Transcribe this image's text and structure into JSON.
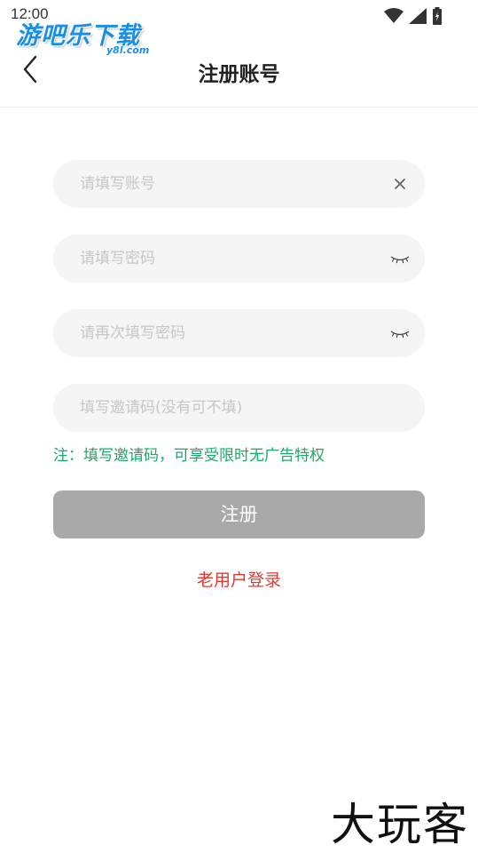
{
  "status_bar": {
    "time": "12:00"
  },
  "watermark": {
    "logo_main": "游吧乐下载",
    "logo_sub": "y8l.com",
    "bottom_text": "大玩客"
  },
  "header": {
    "title": "注册账号"
  },
  "form": {
    "account_placeholder": "请填写账号",
    "password_placeholder": "请填写密码",
    "confirm_password_placeholder": "请再次填写密码",
    "invite_placeholder": "填写邀请码(没有可不填)",
    "note": "注：填写邀请码，可享受限时无广告特权",
    "submit_label": "注册",
    "login_link": "老用户登录"
  },
  "icons": {
    "back": "chevron-left-icon",
    "clear": "close-icon",
    "password_toggle": "eye-closed-icon"
  },
  "colors": {
    "note": "#1aa86a",
    "login_link": "#e03a2f",
    "submit_disabled": "#a9a9a9",
    "field_bg": "#f5f5f5"
  }
}
